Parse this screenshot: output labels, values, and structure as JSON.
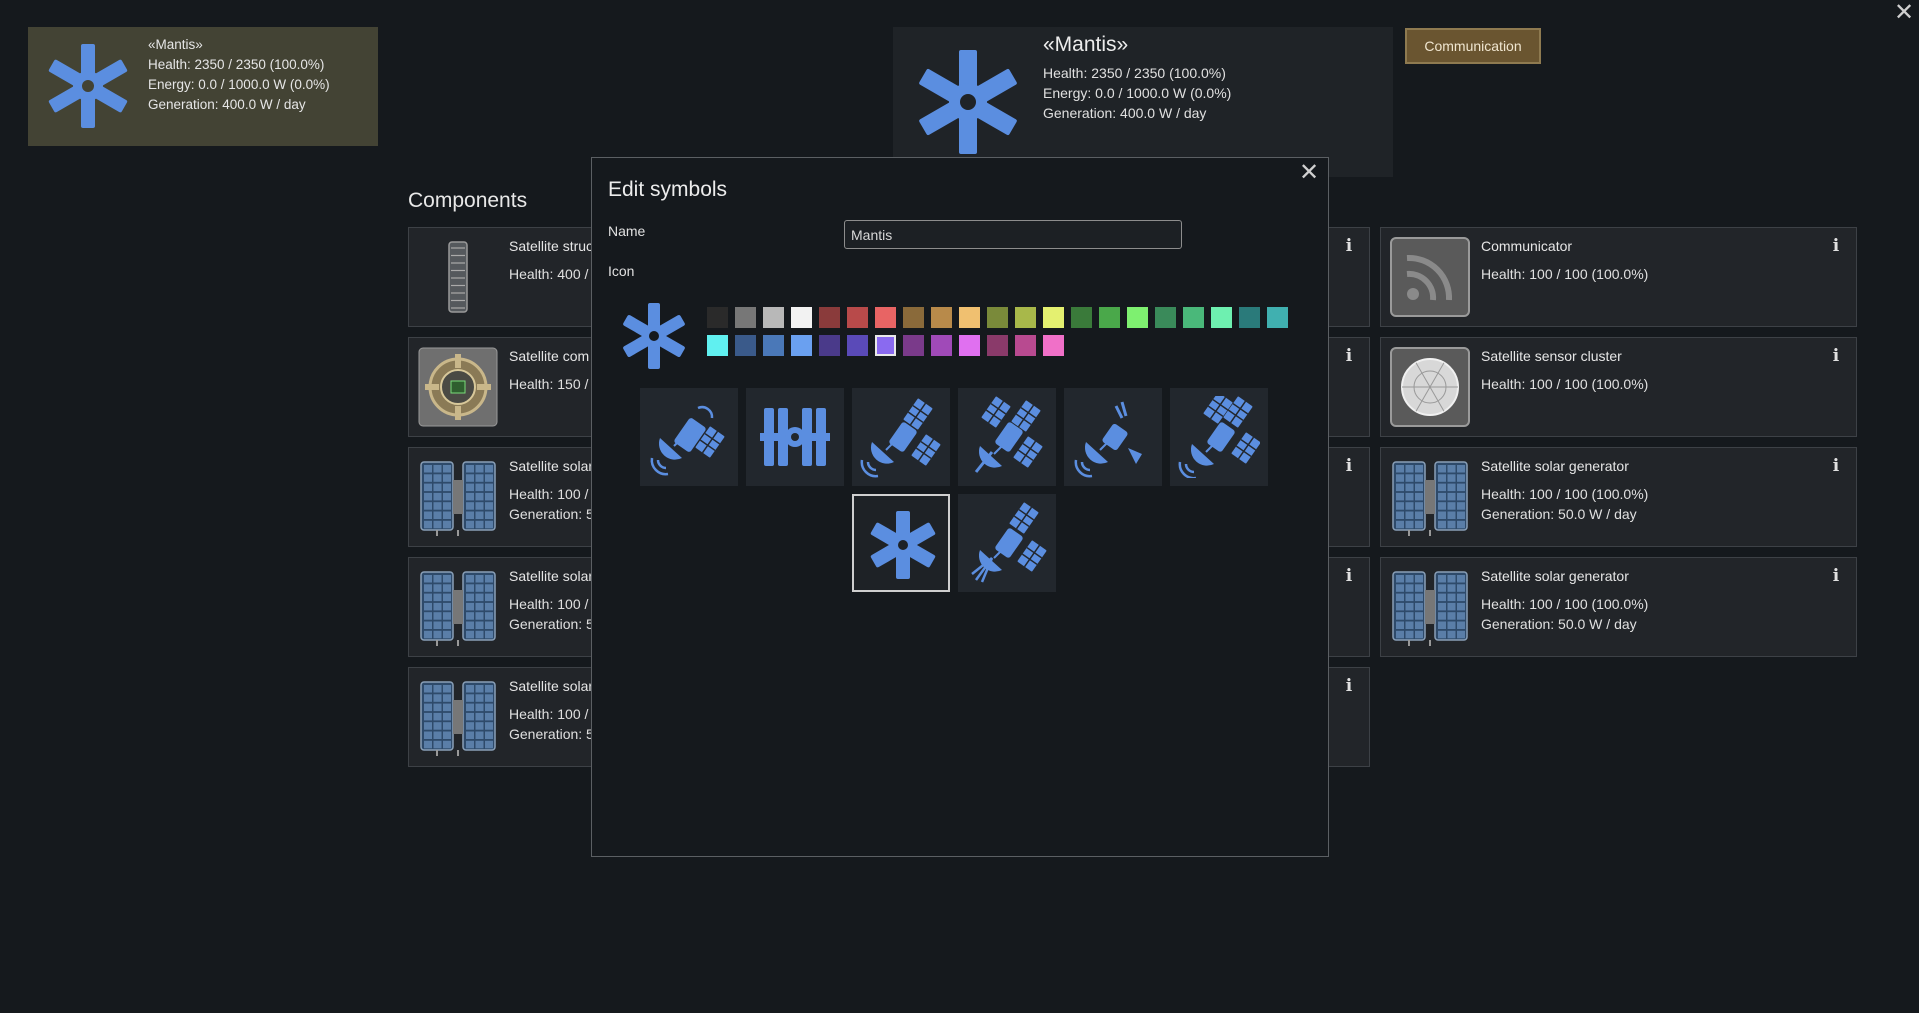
{
  "window": {
    "close_label": "✕"
  },
  "selected_satellite": {
    "name": "«Mantis»",
    "health": "Health: 2350 / 2350 (100.0%)",
    "energy": "Energy: 0.0 / 1000.0 W (0.0%)",
    "generation": "Generation: 400.0 W / day"
  },
  "info_panel": {
    "title": "«Mantis»",
    "health": "Health: 2350 / 2350 (100.0%)",
    "energy": "Energy: 0.0 / 1000.0 W (0.0%)",
    "generation": "Generation: 400.0 W / day"
  },
  "communication_button": "Communication",
  "components": {
    "title": "Components",
    "left": [
      {
        "name": "Satellite struc",
        "stats": [
          "Health: 400 /"
        ],
        "thumb": "structure"
      },
      {
        "name": "Satellite com",
        "stats": [
          "Health: 150 /"
        ],
        "thumb": "computer"
      },
      {
        "name": "Satellite solar",
        "stats": [
          "Health: 100 /",
          "Generation: 5"
        ],
        "thumb": "solar"
      },
      {
        "name": "Satellite solar",
        "stats": [
          "Health: 100 /",
          "Generation: 5"
        ],
        "thumb": "solar"
      },
      {
        "name": "Satellite solar",
        "stats": [
          "Health: 100 /",
          "Generation: 5"
        ],
        "thumb": "solar"
      }
    ],
    "right": [
      {
        "name": "Communicator",
        "stats": [
          "Health: 100 / 100 (100.0%)"
        ],
        "thumb": "communicator"
      },
      {
        "name": "Satellite sensor cluster",
        "stats": [
          "Health: 100 / 100 (100.0%)"
        ],
        "thumb": "sensor"
      },
      {
        "name": "Satellite solar generator",
        "stats": [
          "Health: 100 / 100 (100.0%)",
          "Generation: 50.0 W / day"
        ],
        "thumb": "solar"
      },
      {
        "name": "Satellite solar generator",
        "stats": [
          "Health: 100 / 100 (100.0%)",
          "Generation: 50.0 W / day"
        ],
        "thumb": "solar"
      }
    ],
    "info_glyph": "i"
  },
  "modal": {
    "title": "Edit symbols",
    "close_label": "✕",
    "name_label": "Name",
    "name_value": "Mantis",
    "icon_label": "Icon",
    "selected_color_index": 27,
    "selected_icon_index": 6,
    "colors": [
      "#2a2a2a",
      "#777777",
      "#b8b8b8",
      "#f2f2f2",
      "#8a3b3b",
      "#b84a4a",
      "#e86464",
      "#8a6a3a",
      "#b88a4a",
      "#f0c070",
      "#7a8a3a",
      "#a8b84a",
      "#e4f070",
      "#3a7a3a",
      "#4aa84a",
      "#7ef070",
      "#3a8a5a",
      "#4ab87a",
      "#6ef0b0",
      "#2a7a7a",
      "#40b0b0",
      "#60f0f0",
      "#3a5a8a",
      "#4a78b8",
      "#6aa0f0",
      "#4a3a8a",
      "#5a4ab8",
      "#8a6af0",
      "#7a3a8a",
      "#a04ab8",
      "#e070f0",
      "#8a3a6a",
      "#b84a90",
      "#f070c8"
    ],
    "icons": [
      "dish-satellite-icon",
      "station-icon",
      "solar-dish-satellite-icon",
      "solar-antenna-satellite-icon",
      "drone-satellite-icon",
      "solar-dish-waves-icon",
      "mantis-icon",
      "dish-beam-satellite-icon"
    ],
    "icon_color": "#5b8ee0"
  }
}
